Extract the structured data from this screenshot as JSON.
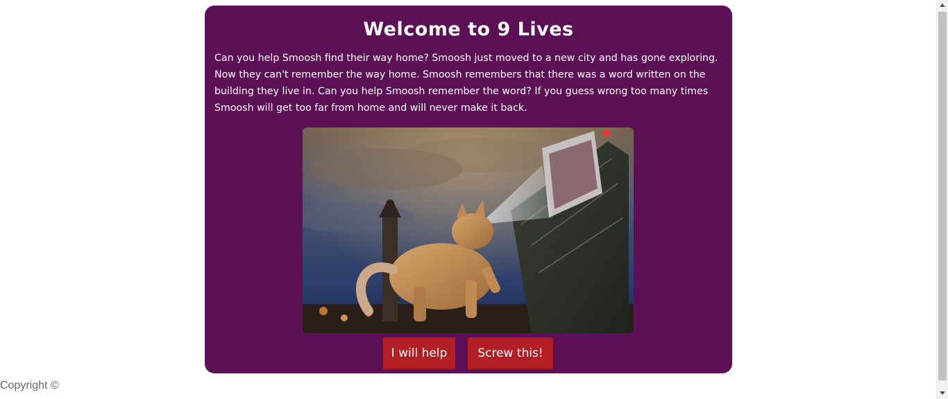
{
  "page": {
    "title": "Welcome to 9 Lives",
    "intro": "Can you help Smoosh find their way home? Smoosh just moved to a new city and has gone exploring. Now they can't remember the way home. Smoosh remembers that there was a word written on the building they live in. Can you help Smoosh remember the word? If you guess wrong too many times Smoosh will get too far from home and will never make it back."
  },
  "hero_image": {
    "icon": "giant-cat-city-photo"
  },
  "buttons": {
    "help_label": "I will help",
    "screw_label": "Screw this!"
  },
  "footer": {
    "copyright": "Copyright ©"
  },
  "colors": {
    "card_background": "#5c1157",
    "button_background": "#b21e24",
    "text": "#ffffff"
  }
}
